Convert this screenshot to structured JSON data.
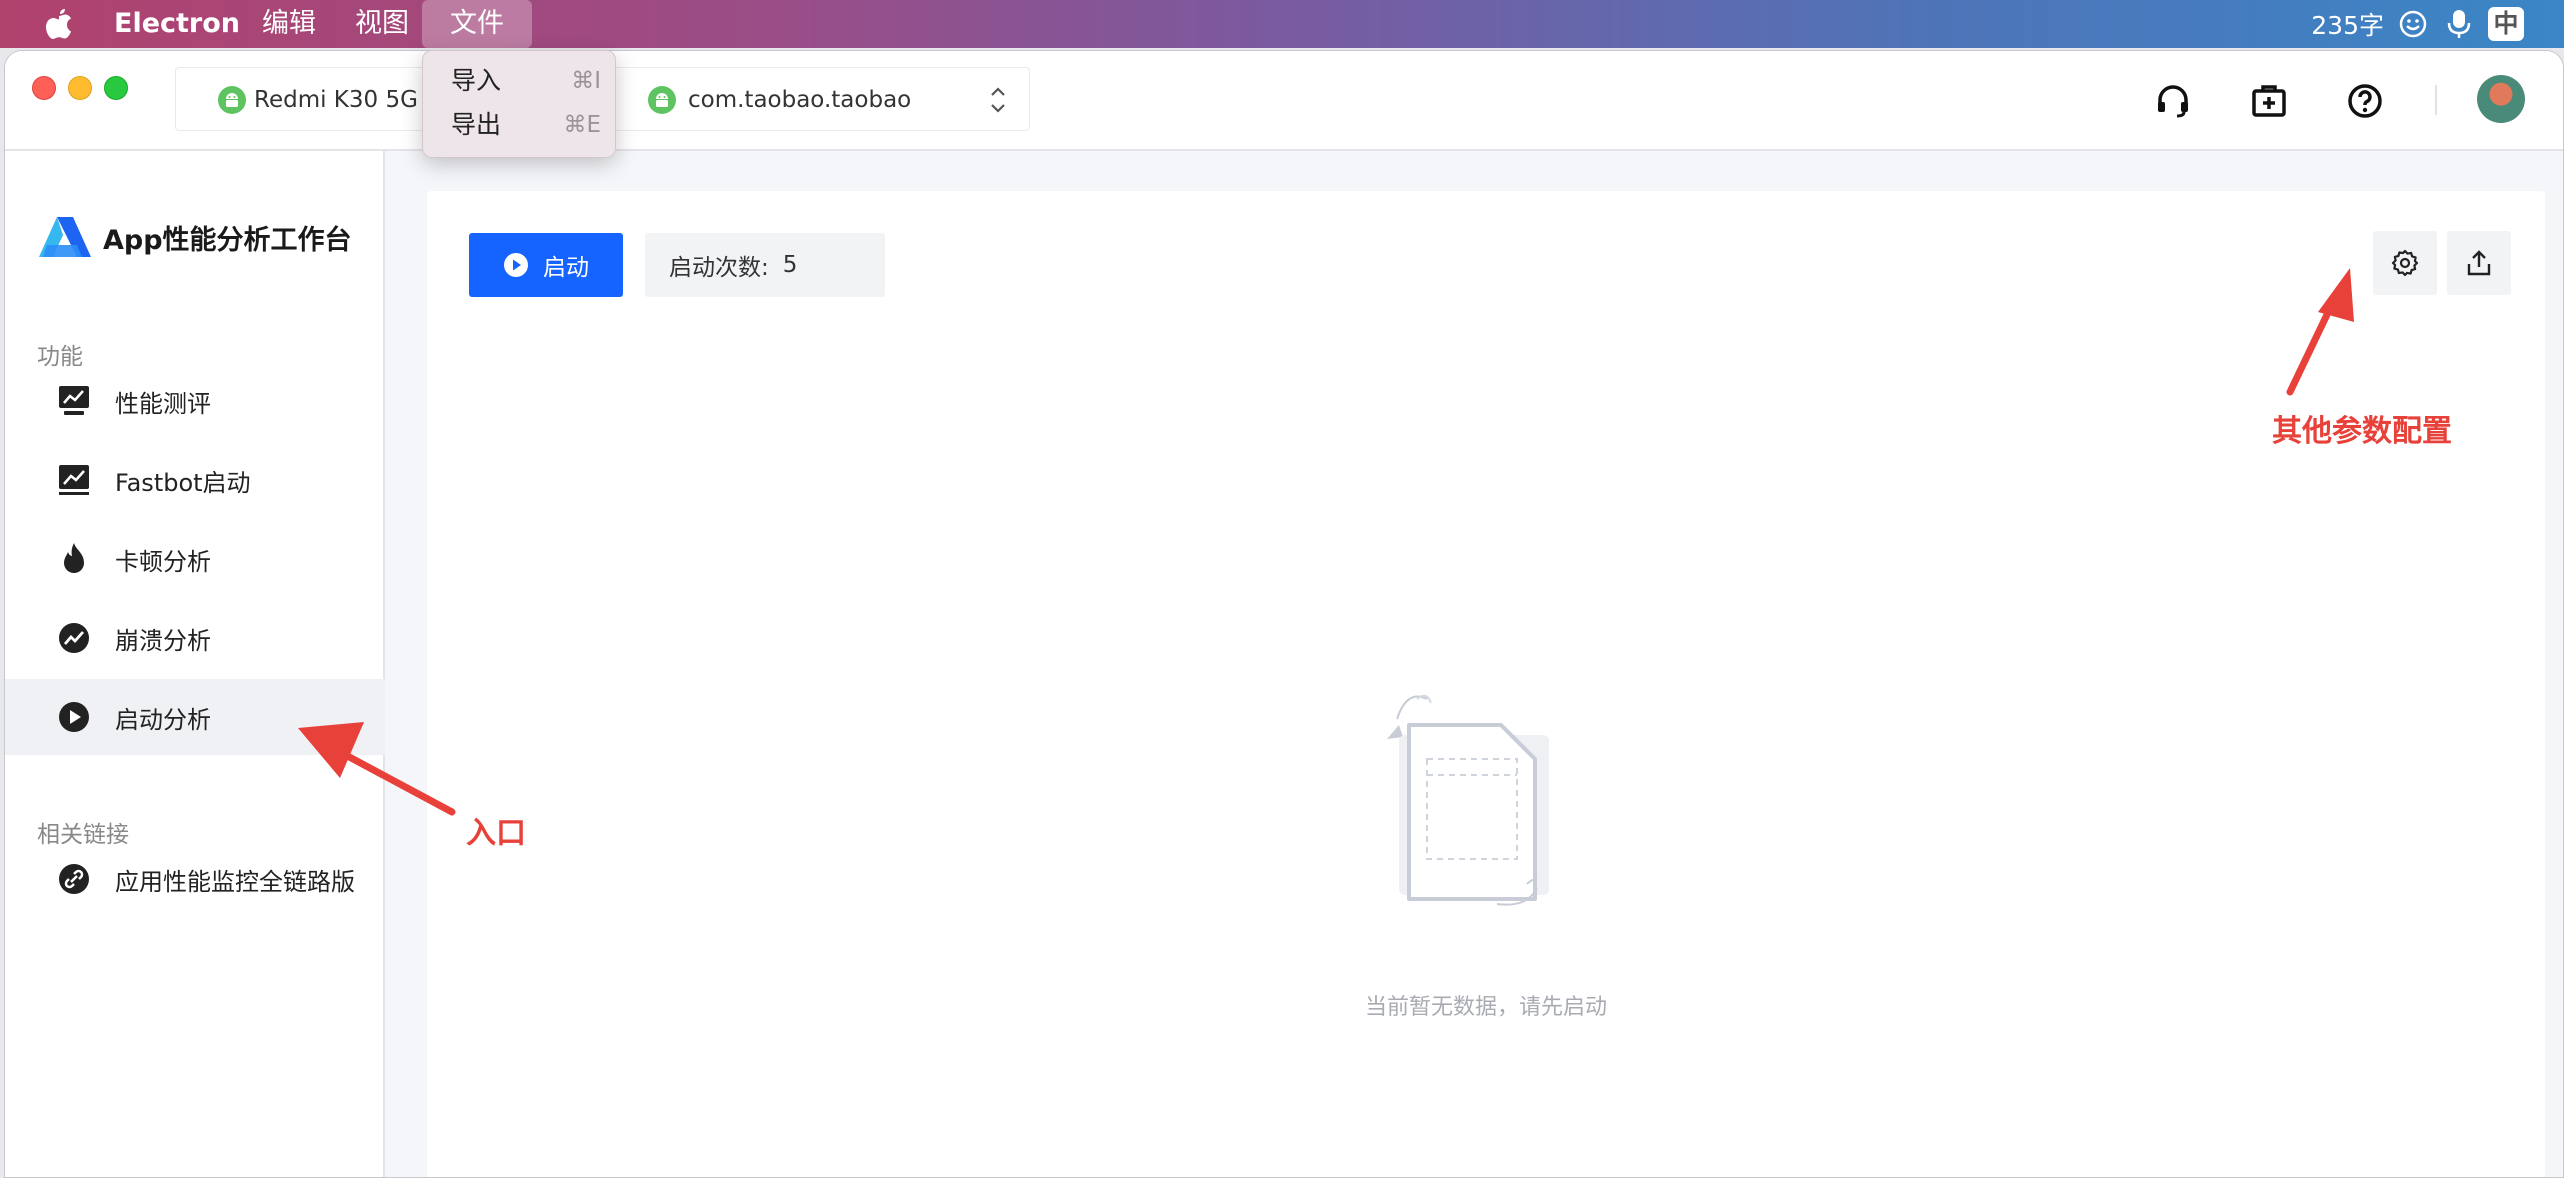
{
  "menubar": {
    "app_name": "Electron",
    "menus": [
      "编辑",
      "视图",
      "文件"
    ],
    "word_count": "235字",
    "ime": "中"
  },
  "file_menu": {
    "items": [
      {
        "label": "导入",
        "shortcut": "⌘I"
      },
      {
        "label": "导出",
        "shortcut": "⌘E"
      }
    ]
  },
  "selector": {
    "device": "Redmi K30 5G",
    "package": "com.taobao.taobao"
  },
  "brand": {
    "title": "App性能分析工作台"
  },
  "sidebar": {
    "section_function": "功能",
    "items": [
      {
        "label": "性能测评",
        "icon": "monitor-chart-icon"
      },
      {
        "label": "Fastbot启动",
        "icon": "trend-chart-icon"
      },
      {
        "label": "卡顿分析",
        "icon": "flame-icon"
      },
      {
        "label": "崩溃分析",
        "icon": "crash-chart-icon"
      },
      {
        "label": "启动分析",
        "icon": "play-circle-icon"
      }
    ],
    "section_links": "相关链接",
    "links": [
      {
        "label": "应用性能监控全链路版",
        "icon": "link-icon"
      }
    ],
    "active_index": 4
  },
  "toolbar": {
    "start_label": "启动",
    "count_label": "启动次数:",
    "count_value": "5"
  },
  "empty": {
    "text": "当前暂无数据，请先启动"
  },
  "annotations": {
    "entry": "入口",
    "settings": "其他参数配置"
  },
  "colors": {
    "primary": "#1664ff",
    "annotation": "#e8413a",
    "android": "#5ec461"
  }
}
